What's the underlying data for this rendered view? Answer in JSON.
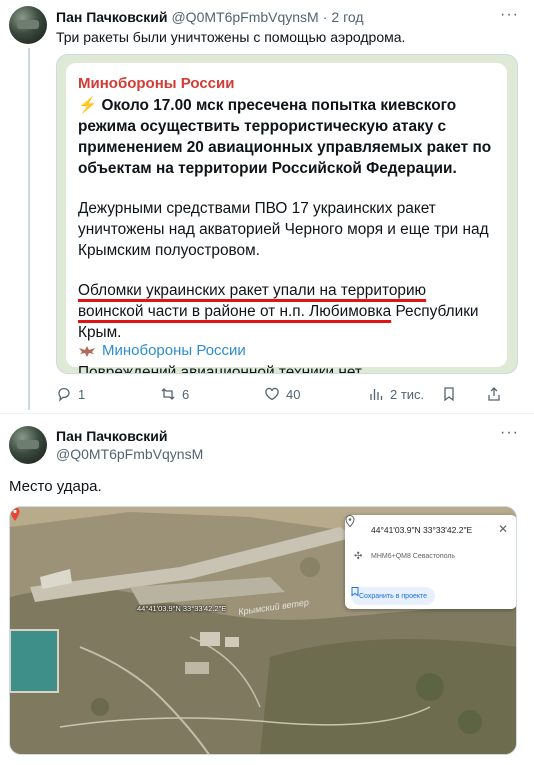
{
  "tweet1": {
    "author_name": "Пан Пачковский",
    "handle": "@Q0MT6pFmbVqynsM",
    "separator": "·",
    "time": "2 год",
    "more": "···",
    "text": "Три ракеты были уничтожены с помощью аэродрома.",
    "card": {
      "channel": "Минобороны России",
      "bolt": "⚡",
      "para1": "Около 17.00 мск пресечена попытка киевского режима осуществить террористическую атаку с применением 20 авиационных управляемых ракет по объектам на территории Российской Федерации.",
      "para2": "Дежурными средствами ПВО 17 украинских ракет уничтожены над акваторией Черного моря и еще три над Крымским полуостровом.",
      "para3_underlined": "Обломки украинских ракет упали на территорию воинской части в районе от н.п. Любимовка",
      "para3_rest": " Республики Крым.",
      "para4": "Повреждений авиационной техники нет.",
      "footer": "Минобороны России"
    },
    "actions": {
      "replies": "1",
      "reposts": "6",
      "likes": "40",
      "views": "2 тис."
    }
  },
  "tweet2": {
    "author_name": "Пан Пачковский",
    "handle": "@Q0MT6pFmbVqynsM",
    "more": "···",
    "text": "Место удара.",
    "map": {
      "coords": "44°41'03.9\"N 33°33'42.2\"E",
      "plus_code": "МНМ6+QМ8 Севастополь",
      "save_label": "Сохранить в проекте",
      "pin_label": "44°41'03.9\"N 33°33'42.2\"E",
      "watermark": "Крымский ветер"
    }
  },
  "colors": {
    "channel_red": "#d33c35",
    "underline_red": "#e01414",
    "link_blue": "#2c8fd0",
    "muted": "#536471"
  }
}
